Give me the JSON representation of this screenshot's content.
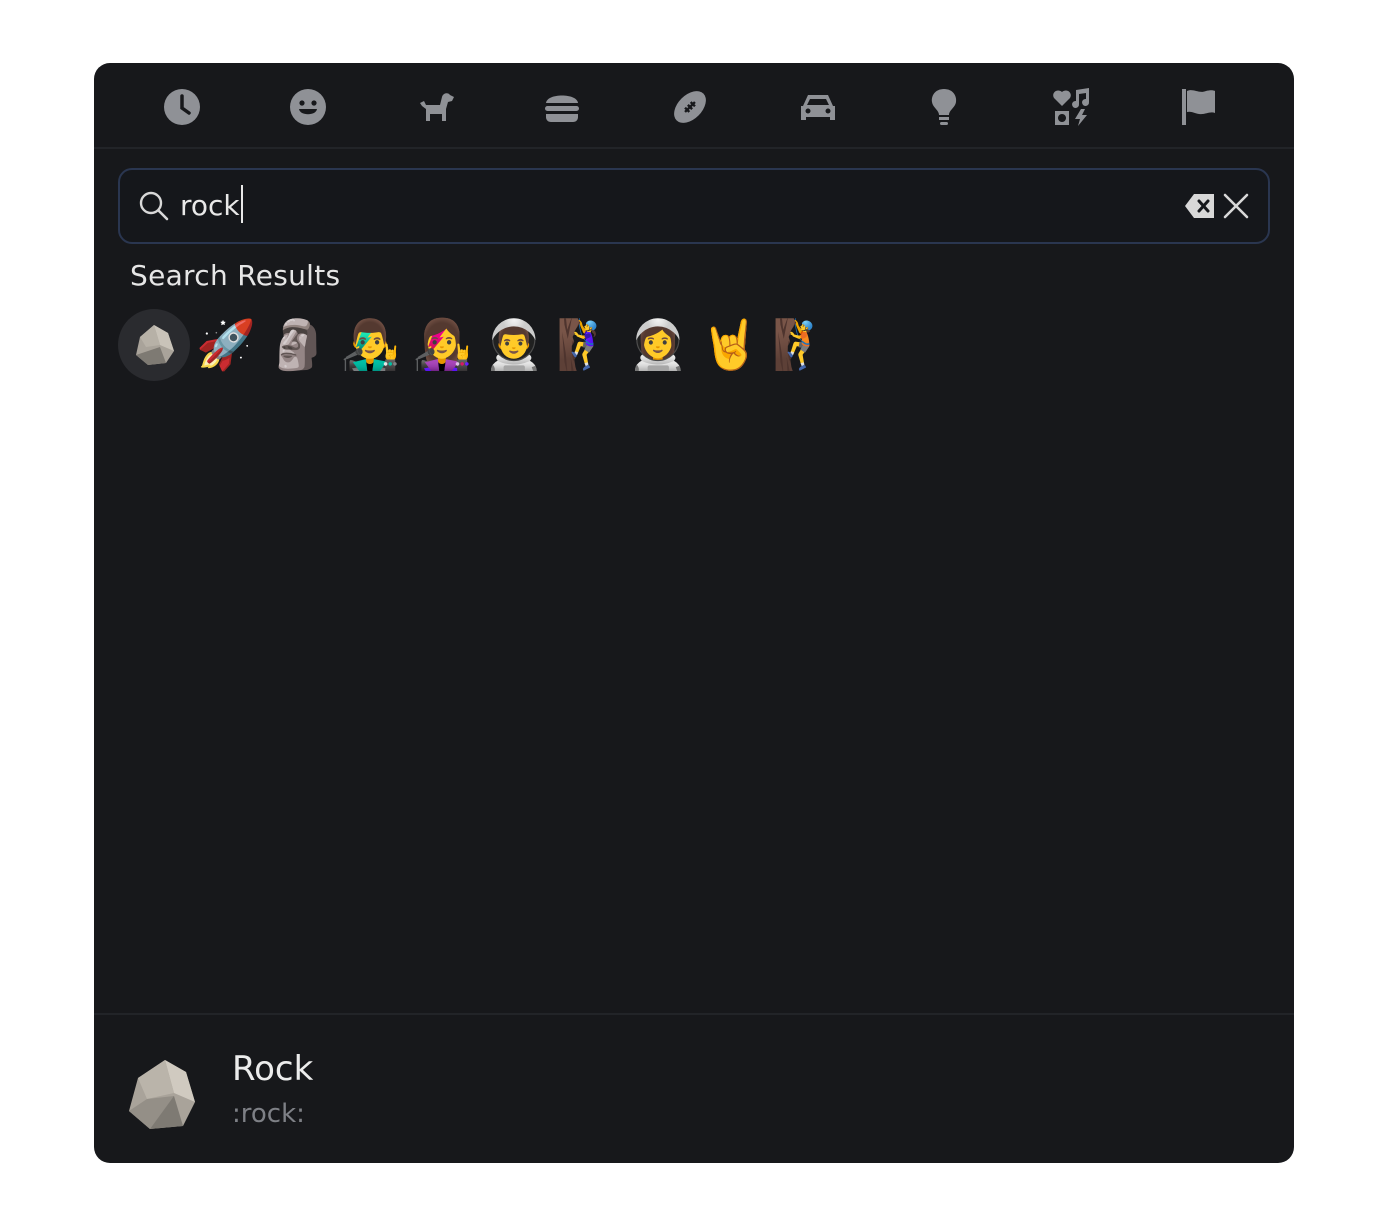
{
  "categories": [
    {
      "name": "recent",
      "icon": "clock-icon"
    },
    {
      "name": "smileys",
      "icon": "smiley-icon"
    },
    {
      "name": "animals",
      "icon": "dog-icon"
    },
    {
      "name": "food",
      "icon": "burger-icon"
    },
    {
      "name": "activities",
      "icon": "football-icon"
    },
    {
      "name": "travel",
      "icon": "car-icon"
    },
    {
      "name": "objects",
      "icon": "lightbulb-icon"
    },
    {
      "name": "symbols",
      "icon": "symbols-icon"
    },
    {
      "name": "flags",
      "icon": "flag-icon"
    }
  ],
  "search": {
    "value": "rock",
    "placeholder": ""
  },
  "results": {
    "title": "Search Results",
    "items": [
      {
        "emoji": "🪨",
        "name": "rock"
      },
      {
        "emoji": "🚀",
        "name": "rocket"
      },
      {
        "emoji": "🗿",
        "name": "moai"
      },
      {
        "emoji": "👨‍🎤",
        "name": "man singer"
      },
      {
        "emoji": "👩‍🎤",
        "name": "woman singer"
      },
      {
        "emoji": "👨‍🚀",
        "name": "man astronaut"
      },
      {
        "emoji": "🧗‍♀️",
        "name": "woman climbing"
      },
      {
        "emoji": "👩‍🚀",
        "name": "woman astronaut"
      },
      {
        "emoji": "🤘",
        "name": "sign of the horns"
      },
      {
        "emoji": "🧗",
        "name": "person climbing"
      }
    ]
  },
  "preview": {
    "name": "Rock",
    "shortcode": ":rock:"
  },
  "colors": {
    "background": "#17181b",
    "icon": "#8f9196",
    "search_border": "#2a3650",
    "selected": "#2a2b2f"
  }
}
